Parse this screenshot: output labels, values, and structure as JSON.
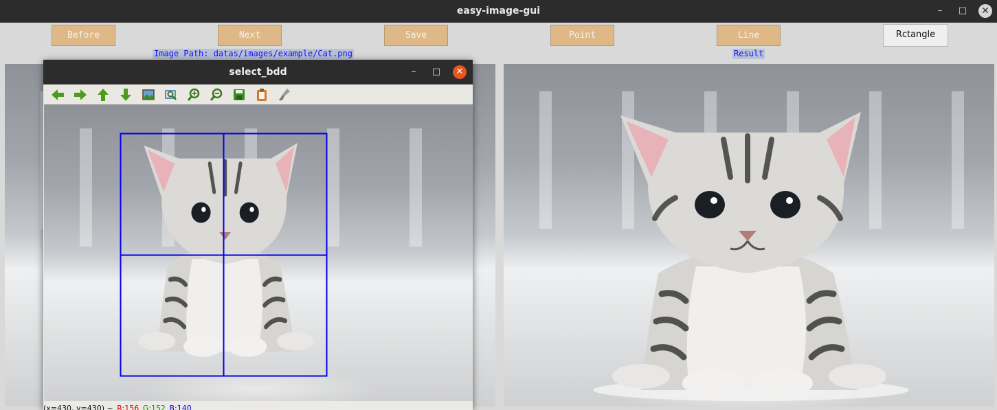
{
  "window": {
    "title": "easy-image-gui",
    "minimize_glyph": "–",
    "maximize_glyph": "□",
    "close_glyph": "✕"
  },
  "toolbar": {
    "buttons": [
      {
        "label": "Before"
      },
      {
        "label": "Next"
      },
      {
        "label": "Save"
      },
      {
        "label": "Point"
      },
      {
        "label": "Line"
      },
      {
        "label": "Rctangle",
        "active": true
      }
    ],
    "image_path": "Image Path: datas/images/example/Cat.png",
    "result_label": "Result",
    "button_color": "#deb887",
    "label_color": "#1010ff"
  },
  "popup": {
    "title": "select_bdd",
    "minimize_glyph": "–",
    "maximize_glyph": "□",
    "close_glyph": "✕",
    "close_color": "#e95420",
    "tools": [
      "arrow-left-icon",
      "arrow-right-icon",
      "arrow-up-icon",
      "arrow-down-icon",
      "image-icon",
      "zoom-rect-icon",
      "zoom-in-icon",
      "zoom-out-icon",
      "save-icon",
      "clipboard-icon",
      "brush-icon"
    ],
    "status": {
      "coords": "(x=430, y=430) ~",
      "r": "R:156",
      "g": "G:152",
      "b": "B:140"
    },
    "grid_color": "#0000ee"
  }
}
